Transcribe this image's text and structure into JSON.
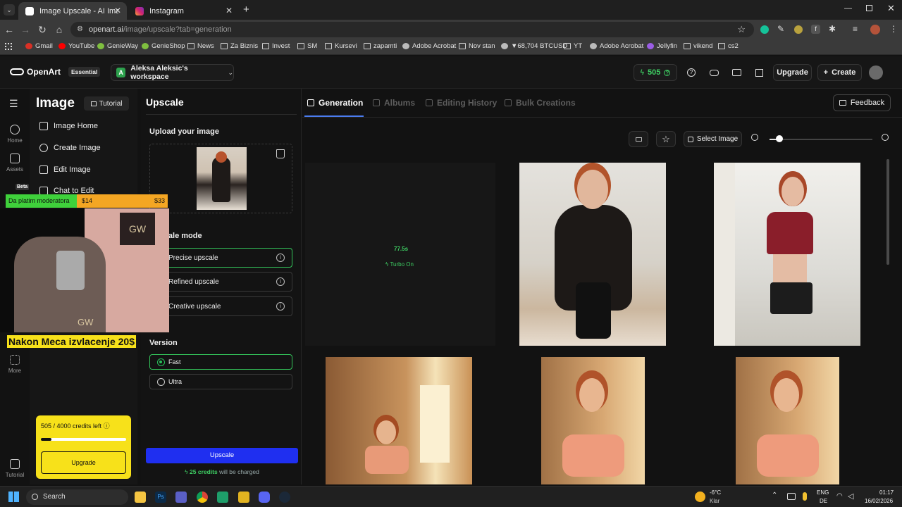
{
  "browser": {
    "tabs": [
      {
        "label": "Image Upscale - AI Image Upsc",
        "active": true
      },
      {
        "label": "Instagram",
        "active": false
      }
    ],
    "url_host": "openart.ai",
    "url_path": "/image/upscale?tab=generation",
    "bookmarks": [
      "Gmail",
      "YouTube",
      "GenieWay",
      "GenieShop",
      "News",
      "Za Biznis",
      "Invest",
      "SM",
      "Kursevi",
      "zapamti",
      "Adobe Acrobat",
      "Nov stan",
      "▼68,704 BTCUSD",
      "YT",
      "Adobe Acrobat",
      "Jellyfin",
      "vikend",
      "cs2"
    ]
  },
  "header": {
    "logo": "OpenArt",
    "plan_badge": "Essential",
    "workspace_initial": "A",
    "workspace_name": "Aleksa Aleksic's workspace",
    "credits": "505",
    "upgrade_label": "Upgrade",
    "create_label": "Create"
  },
  "rail": {
    "items": [
      {
        "label": "Home",
        "icon": "home-icon"
      },
      {
        "label": "Assets",
        "icon": "folder-icon"
      },
      {
        "label": "More",
        "icon": "grid-icon"
      },
      {
        "label": "Tutorial",
        "icon": "book-icon"
      }
    ],
    "beta": "Beta"
  },
  "image_menu": {
    "title": "Image",
    "tutorial": "Tutorial",
    "items": [
      "Image Home",
      "Create Image",
      "Edit Image",
      "Chat to Edit"
    ]
  },
  "credits_box": {
    "text": "505 / 4000 credits left",
    "progress_fraction": 0.126,
    "upgrade": "Upgrade"
  },
  "upscale": {
    "title": "Upscale",
    "upload_label": "Upload your image",
    "mode_label": "Upscale mode",
    "modes": [
      "Precise upscale",
      "Refined upscale",
      "Creative upscale"
    ],
    "version_label": "Version",
    "versions": [
      "Fast",
      "Ultra"
    ],
    "button": "Upscale",
    "charge_prefix": "25 credits",
    "charge_suffix": "will be charged"
  },
  "gallery": {
    "tabs": [
      "Generation",
      "Albums",
      "Editing History",
      "Bulk Creations"
    ],
    "feedback": "Feedback",
    "select_image": "Select Image",
    "pending_time": "77.5s",
    "turbo": "Turbo On"
  },
  "overlay": {
    "donation_label": "Da platim moderatora",
    "donation_now": "$14",
    "donation_goal": "$33",
    "caption": "Nakon Meca izvlacenje 20$",
    "watermark": "GW"
  },
  "taskbar": {
    "search": "Search",
    "weather_temp": "-6°C",
    "weather_desc": "Klar",
    "lang_top": "ENG",
    "lang_bottom": "DE",
    "time": "01:17",
    "date": "16/02/2026"
  },
  "colors": {
    "accent_green": "#3ecf63",
    "upscale_blue": "#1f2ff0",
    "credits_yellow": "#f7e11a",
    "donation_green": "#3fd13b",
    "donation_orange": "#f4a623"
  }
}
